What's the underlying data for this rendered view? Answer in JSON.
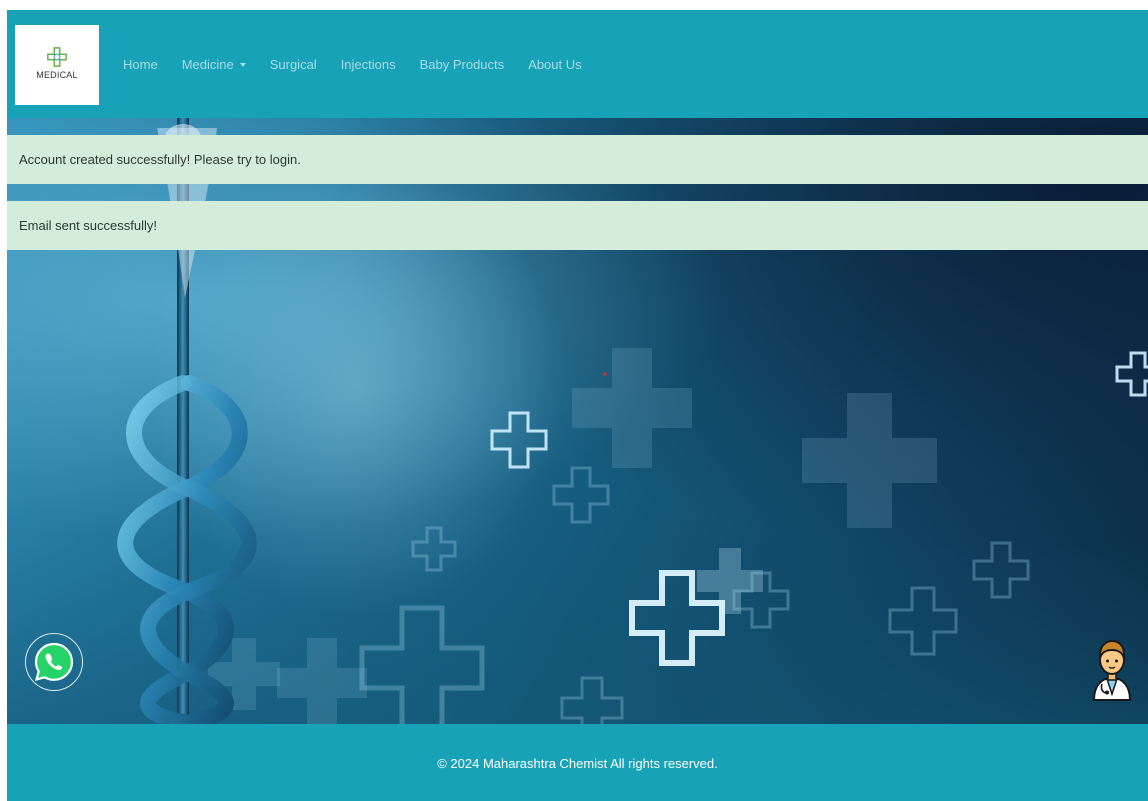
{
  "brand": {
    "logo_text": "MEDICAL",
    "logo_icon": "medical-cross-logo-icon",
    "primary_color": "#17a2b8"
  },
  "nav": {
    "items": [
      {
        "label": "Home"
      },
      {
        "label": "Medicine",
        "has_dropdown": true
      },
      {
        "label": "Surgical"
      },
      {
        "label": "Injections"
      },
      {
        "label": "Baby Products"
      },
      {
        "label": "About Us"
      }
    ]
  },
  "alerts": [
    {
      "message": "Account created successfully! Please try to login.",
      "color": "#d4edda"
    },
    {
      "message": "Email sent successfully!",
      "color": "#d4edda"
    }
  ],
  "floating": {
    "whatsapp_icon": "whatsapp-icon",
    "doctor_icon": "doctor-avatar-icon"
  },
  "footer": {
    "text": "© 2024 Maharashtra Chemist All rights reserved."
  }
}
